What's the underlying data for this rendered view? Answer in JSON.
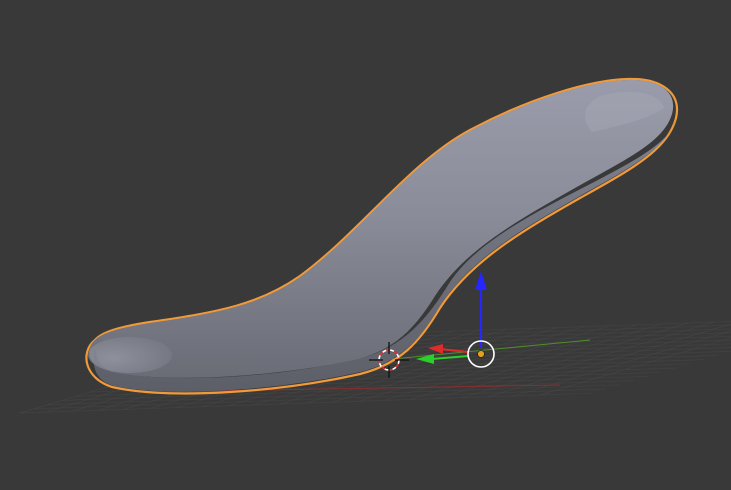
{
  "viewport": {
    "background": "#393939",
    "view": "3d-viewport"
  },
  "object": {
    "type": "mesh",
    "shape": "curved-insole",
    "selected": true,
    "selection_outline_color": "#f19a3a",
    "body_color": "#8a8c99"
  },
  "grid": {
    "floor_grid": true,
    "line_color": "#4a4a4a",
    "x_axis_color": "#a83232",
    "y_axis_color": "#5aa02c"
  },
  "gizmo": {
    "type": "translate",
    "x_axis_color": "#e02b2b",
    "y_axis_color": "#2ad02a",
    "z_axis_color": "#2626ff",
    "origin_color": "#e0a020"
  },
  "cursor_3d": {
    "visible": true,
    "colors": [
      "#e03030",
      "#ffffff"
    ]
  }
}
